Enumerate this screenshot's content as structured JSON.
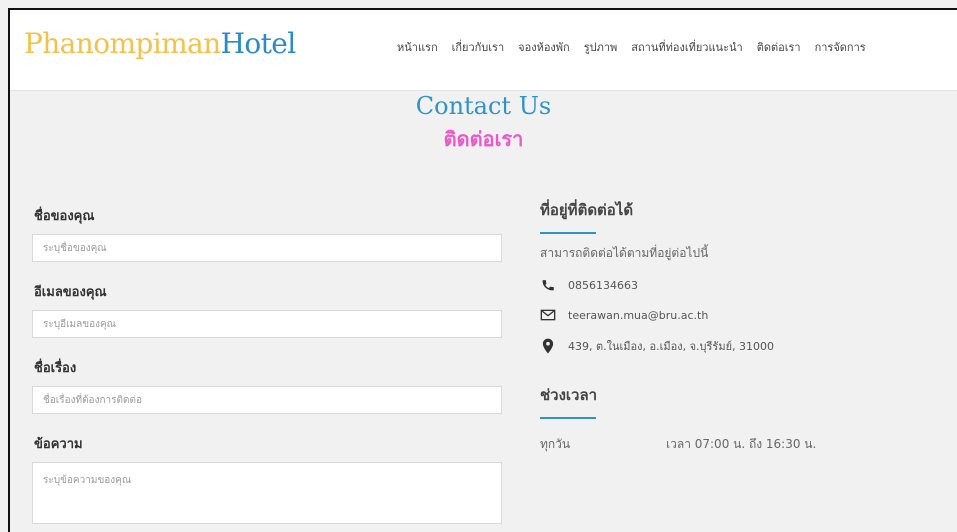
{
  "header": {
    "brand_part1": "Phanompiman",
    "brand_part2": "Hotel",
    "nav": [
      {
        "label": "หน้าแรก"
      },
      {
        "label": "เกี่ยวกับเรา"
      },
      {
        "label": "จองห้องพัก"
      },
      {
        "label": "รูปภาพ"
      },
      {
        "label": "สถานที่ท่องเที่ยวแนะนำ"
      },
      {
        "label": "ติดต่อเรา"
      },
      {
        "label": "การจัดการ"
      }
    ]
  },
  "page": {
    "title_en": "Contact Us",
    "title_th": "ติดต่อเรา"
  },
  "form": {
    "name": {
      "label": "ชื่อของคุณ",
      "placeholder": "ระบุชื่อของคุณ",
      "value": ""
    },
    "email": {
      "label": "อีเมลของคุณ",
      "placeholder": "ระบุอีเมลของคุณ",
      "value": ""
    },
    "subject": {
      "label": "ชื่อเรื่อง",
      "placeholder": "ชื่อเรื่องที่ต้องการติดต่อ",
      "value": ""
    },
    "message": {
      "label": "ข้อความ",
      "placeholder": "ระบุข้อความของคุณ",
      "value": ""
    }
  },
  "contact": {
    "heading": "ที่อยู่ที่ติดต่อได้",
    "subtext": "สามารถติดต่อได้ตามที่อยู่ต่อไปนี้",
    "phone": "0856134663",
    "email": "teerawan.mua@bru.ac.th",
    "address": "439, ต.ในเมือง, อ.เมือง, จ.บุรีรัมย์, 31000",
    "time_heading": "ช่วงเวลา",
    "hours": {
      "day": "ทุกวัน",
      "time": "เวลา 07:00 น. ถึง 16:30 น."
    }
  },
  "colors": {
    "brand_yellow": "#f2c24c",
    "brand_blue": "#2b8ac8",
    "title_pink": "#e85ac8",
    "accent_blue": "#2f93c8"
  }
}
